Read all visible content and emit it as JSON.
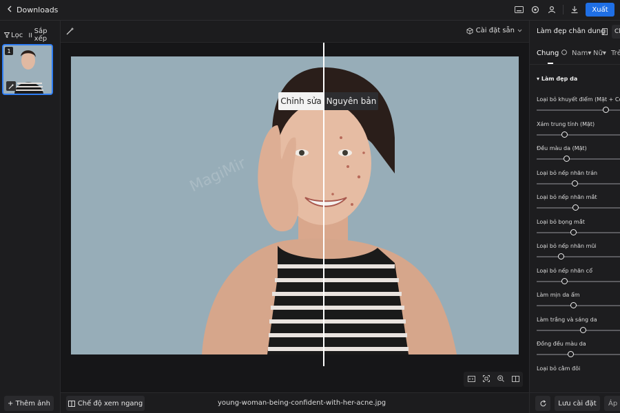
{
  "topbar": {
    "back_label": "Downloads",
    "export_label": "Xuất",
    "icons": [
      "keyboard-icon",
      "settings-icon",
      "user-icon",
      "download-icon"
    ]
  },
  "left": {
    "filter_label": "Lọc",
    "sort_label": "Sắp xếp",
    "thumb_number": "1",
    "add_label": "+ Thêm ảnh"
  },
  "canvas": {
    "preset_label": "Cài đặt sẵn",
    "label_edited": "Chỉnh sửa",
    "label_original": "Nguyên bản",
    "watermark": "MagiMir",
    "view_mode_label": "Chế độ xem ngang",
    "filename": "young-woman-being-confident-with-her-acne.jpg"
  },
  "right": {
    "title": "Làm đẹp chân dung",
    "header_tab": "Ch",
    "tabs": [
      "Chung",
      "Nam",
      "Nữ",
      "Trẻ"
    ],
    "section_title": "Làm đẹp da",
    "sliders": [
      {
        "label": "Loại bỏ khuyết điểm (Mặt + Cơ",
        "value": 1.0
      },
      {
        "label": "Xám trung tính (Mặt)",
        "value": 0.4
      },
      {
        "label": "Đều màu da (Mặt)",
        "value": 0.43
      },
      {
        "label": "Loại bỏ nếp nhăn trán",
        "value": 0.55
      },
      {
        "label": "Loại bỏ nếp nhăn mắt",
        "value": 0.56
      },
      {
        "label": "Loại bỏ bọng mắt",
        "value": 0.53
      },
      {
        "label": "Loại bỏ nếp nhăn mũi",
        "value": 0.35
      },
      {
        "label": "Loại bỏ nếp nhăn cổ",
        "value": 0.4
      },
      {
        "label": "Làm mịn da ẩm",
        "value": 0.53
      },
      {
        "label": "Làm trắng và sáng da",
        "value": 0.67
      },
      {
        "label": "Đồng đều màu da",
        "value": 0.49
      },
      {
        "label": "Loại bỏ cằm đôi",
        "value": null
      }
    ],
    "save_label": "Lưu cài đặt",
    "apply_label": "Áp"
  }
}
